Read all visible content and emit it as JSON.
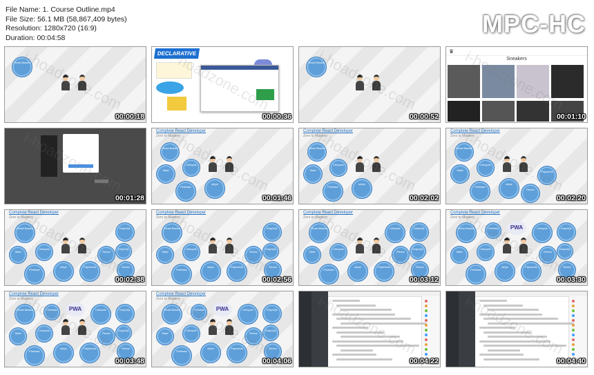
{
  "info": {
    "file_name": "File Name: 1. Course Outline.mp4",
    "file_size": "File Size: 56.1 MB (58,867,409 bytes)",
    "resolution": "Resolution: 1280x720 (16:9)",
    "duration": "Duration: 00:04:58"
  },
  "logo": "MPC-HC",
  "slide": {
    "title": "Complete React Developer",
    "subtitle": "Zero to Mastery"
  },
  "thumbnails": [
    {
      "timestamp": "00:00:18"
    },
    {
      "timestamp": "00:00:36",
      "banner": "DECLARATIVE"
    },
    {
      "timestamp": "00:00:52"
    },
    {
      "timestamp": "00:01:10",
      "shop_title": "Sneakers"
    },
    {
      "timestamp": "00:01:28"
    },
    {
      "timestamp": "00:01:46"
    },
    {
      "timestamp": "00:02:02"
    },
    {
      "timestamp": "00:02:20"
    },
    {
      "timestamp": "00:02:38"
    },
    {
      "timestamp": "00:02:56"
    },
    {
      "timestamp": "00:03:12"
    },
    {
      "timestamp": "00:03:30"
    },
    {
      "timestamp": "00:03:48"
    },
    {
      "timestamp": "00:04:06"
    },
    {
      "timestamp": "00:04:22"
    },
    {
      "timestamp": "00:04:40"
    }
  ],
  "bubble_labels": {
    "react_basics": "React Basics",
    "lifecycle": "Lifecycle",
    "state": "State",
    "firebase": "Firebase",
    "stripe": "stripe",
    "payments": "Payments",
    "redux": "Redux",
    "graphql": "GraphQL",
    "pwa": "PWA"
  },
  "watermark": "i-hoadzone.com",
  "colors": {
    "bubble": "#5e9fd9",
    "title_link": "#1f6fbf"
  }
}
